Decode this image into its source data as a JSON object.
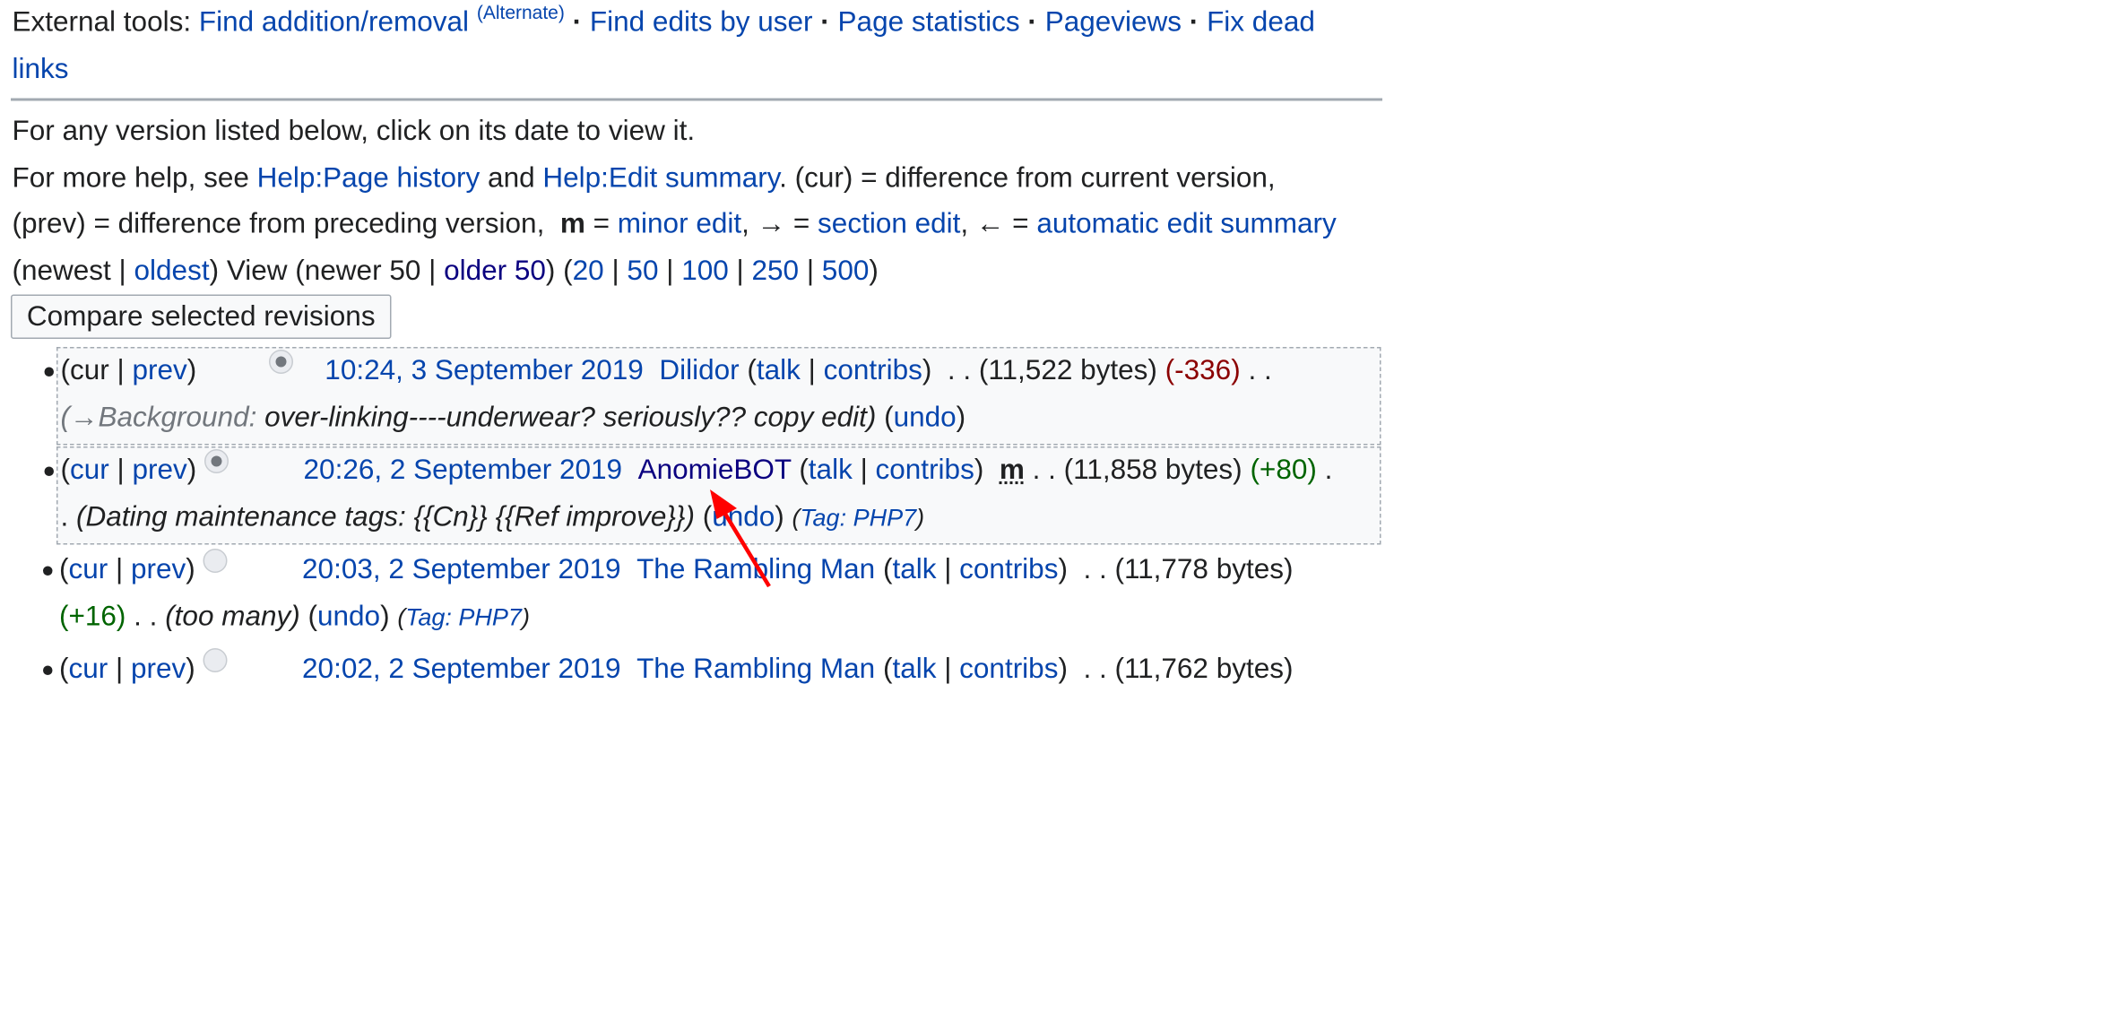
{
  "tools": {
    "label": "External tools:",
    "find_addition": "Find addition/removal",
    "alternate": "(Alternate)",
    "find_edits": "Find edits by user",
    "page_stats": "Page statistics",
    "pageviews": "Pageviews",
    "fix_dead_a": "Fix dead",
    "fix_dead_b": "links",
    "separator": "·"
  },
  "help": {
    "line1": "For any version listed below, click on its date to view it.",
    "line2_pre": "For more help, see",
    "help_history": "Help:Page history",
    "and": "and",
    "help_summary": "Help:Edit summary",
    "line2_post": ". (cur) = difference from current version,",
    "line3_pre": "(prev) = difference from preceding version,",
    "m": "m",
    "eq_minor": "=",
    "minor_edit": "minor edit",
    "section_arrow": ", → =",
    "section_edit": "section edit",
    "auto_arrow": ", ← =",
    "auto_summary": "automatic edit summary"
  },
  "nav": {
    "newest": "(newest |",
    "oldest": "oldest",
    "view": ") View (newer 50 |",
    "older": "older 50",
    "close_open": ") (",
    "n20": "20",
    "n50": "50",
    "n100": "100",
    "n250": "250",
    "n500": "500",
    "close": ")",
    "bar": "|"
  },
  "compare_button": "Compare selected revisions",
  "revisions": [
    {
      "cur": "cur",
      "prev": "prev",
      "date": "10:24, 3 September 2019",
      "user": "Dilidor",
      "talk": "talk",
      "contribs": "contribs",
      "minor": "",
      "size": "(11,522 bytes)",
      "diff": "(-336)",
      "auto": "(→Background:",
      "comment": "over-linking----underwear? seriously?? copy edit)",
      "undo": "undo",
      "tag_label": "",
      "tag": ""
    },
    {
      "cur": "cur",
      "prev": "prev",
      "date": "20:26, 2 September 2019",
      "user": "AnomieBOT",
      "talk": "talk",
      "contribs": "contribs",
      "minor": "m",
      "size": "(11,858 bytes)",
      "diff": "(+80)",
      "auto": "",
      "comment": "(Dating maintenance tags: {{Cn}} {{Ref improve}})",
      "undo": "undo",
      "tag_label": "Tag:",
      "tag": "PHP7"
    },
    {
      "cur": "cur",
      "prev": "prev",
      "date": "20:03, 2 September 2019",
      "user": "The Rambling Man",
      "talk": "talk",
      "contribs": "contribs",
      "minor": "",
      "size": "(11,778 bytes)",
      "diff": "(+16)",
      "auto": "",
      "comment": "(too many)",
      "undo": "undo",
      "tag_label": "Tag:",
      "tag": "PHP7"
    },
    {
      "cur": "cur",
      "prev": "prev",
      "date": "20:02, 2 September 2019",
      "user": "The Rambling Man",
      "talk": "talk",
      "contribs": "contribs",
      "size": "(11,762 bytes)"
    }
  ],
  "colors": {
    "link": "#0645ad",
    "visited_link": "#0b0080",
    "negative_diff": "#8b0000",
    "positive_diff": "#006400",
    "annotation_arrow": "#ff0000"
  }
}
